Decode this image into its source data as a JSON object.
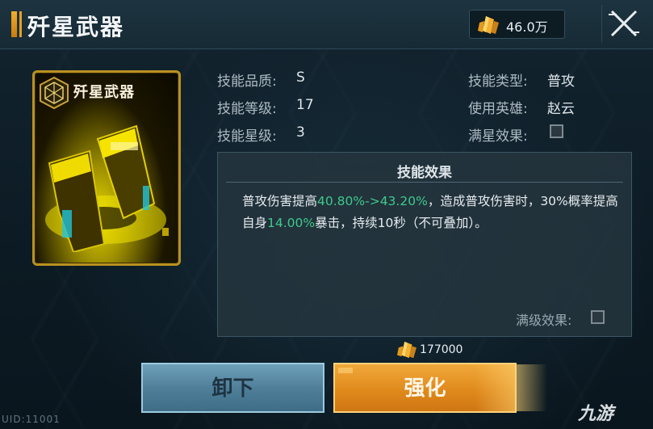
{
  "header": {
    "title": "歼星武器",
    "currency_icon": "gold-crystal-icon",
    "currency_amount": "46.0万"
  },
  "card": {
    "title": "歼星武器",
    "emblem_icon": "hex-emblem-icon",
    "weapon_art": "golden-twin-cannon"
  },
  "skill_info": {
    "quality_label": "技能品质:",
    "quality_value": "S",
    "level_label": "技能等级:",
    "level_value": "17",
    "star_label": "技能星级:",
    "star_value": "3",
    "type_label": "技能类型:",
    "type_value": "普攻",
    "hero_label": "使用英雄:",
    "hero_value": "赵云",
    "max_star_label": "满星效果:"
  },
  "effect": {
    "title": "技能效果",
    "text_1": "普攻伤害提高",
    "highlight_1": "40.80%->43.20%",
    "text_2": "，造成普攻伤害时，30%概率提高自身",
    "highlight_2": "14.00%",
    "text_3": "暴击，持续10秒（不可叠加）。",
    "max_level_label": "满级效果:"
  },
  "upgrade_cost": {
    "icon": "gold-crystal-icon",
    "amount": "177000"
  },
  "buttons": {
    "unequip": "卸下",
    "upgrade": "强化"
  },
  "footer": {
    "uid": "UID:11001",
    "watermark": "九游"
  },
  "colors": {
    "accent_gold": "#e9a020",
    "highlight_green": "#3ec98a",
    "unequip_blue": "#4f7f99",
    "upgrade_orange": "#e08a1c"
  }
}
